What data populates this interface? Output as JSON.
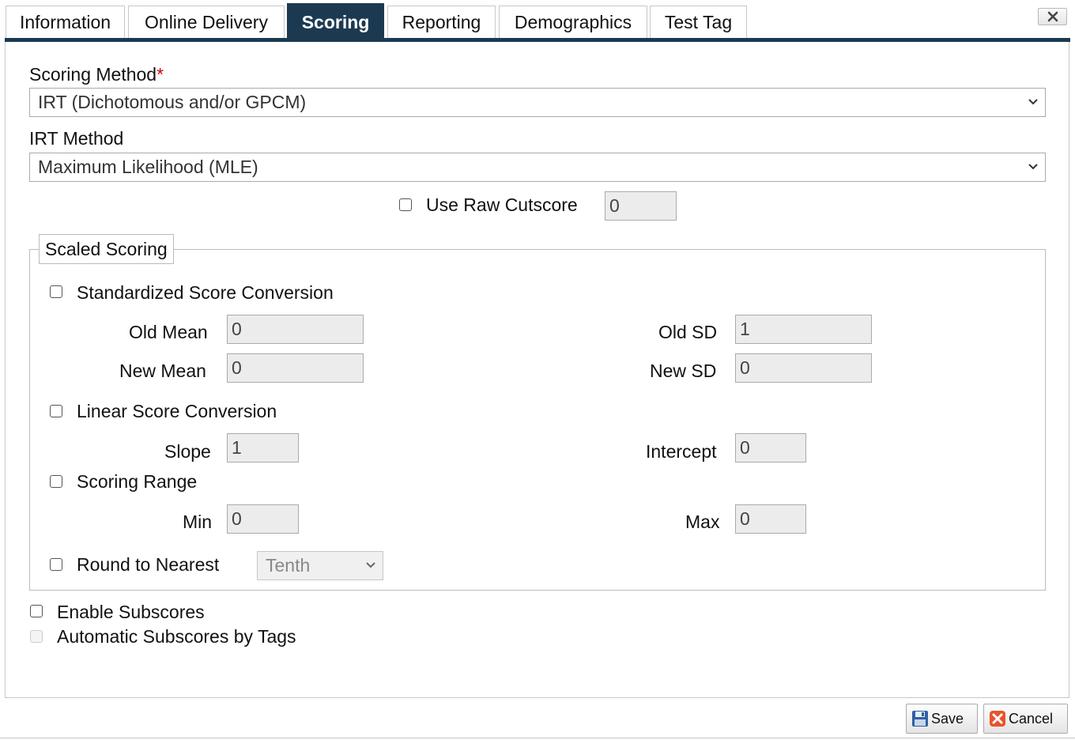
{
  "tabs": [
    {
      "label": "Information"
    },
    {
      "label": "Online Delivery"
    },
    {
      "label": "Scoring"
    },
    {
      "label": "Reporting"
    },
    {
      "label": "Demographics"
    },
    {
      "label": "Test Tag"
    }
  ],
  "active_tab": "Scoring",
  "scoring_method": {
    "label": "Scoring Method",
    "required_mark": "*",
    "value": "IRT (Dichotomous and/or GPCM)"
  },
  "irt_method": {
    "label": "IRT Method",
    "value": "Maximum Likelihood (MLE)"
  },
  "raw_cutscore": {
    "label": "Use Raw Cutscore",
    "value": "0",
    "checked": false
  },
  "scaled_scoring": {
    "legend": "Scaled Scoring",
    "standardized": {
      "label": "Standardized Score Conversion",
      "old_mean_label": "Old Mean",
      "old_mean": "0",
      "new_mean_label": "New Mean",
      "new_mean": "0",
      "old_sd_label": "Old SD",
      "old_sd": "1",
      "new_sd_label": "New SD",
      "new_sd": "0"
    },
    "linear": {
      "label": "Linear Score Conversion",
      "slope_label": "Slope",
      "slope": "1",
      "intercept_label": "Intercept",
      "intercept": "0"
    },
    "range": {
      "label": "Scoring Range",
      "min_label": "Min",
      "min": "0",
      "max_label": "Max",
      "max": "0"
    },
    "round": {
      "label": "Round to Nearest",
      "value": "Tenth"
    }
  },
  "enable_subscores": {
    "label": "Enable Subscores"
  },
  "auto_subscores": {
    "label": "Automatic Subscores by Tags"
  },
  "buttons": {
    "save": "Save",
    "cancel": "Cancel"
  },
  "colors": {
    "accent": "#1b3a52",
    "required": "#d40000"
  },
  "icons": {
    "close": "close-icon",
    "save": "floppy-disk-icon",
    "cancel": "cancel-x-icon",
    "dropdown": "chevron-down-icon"
  }
}
